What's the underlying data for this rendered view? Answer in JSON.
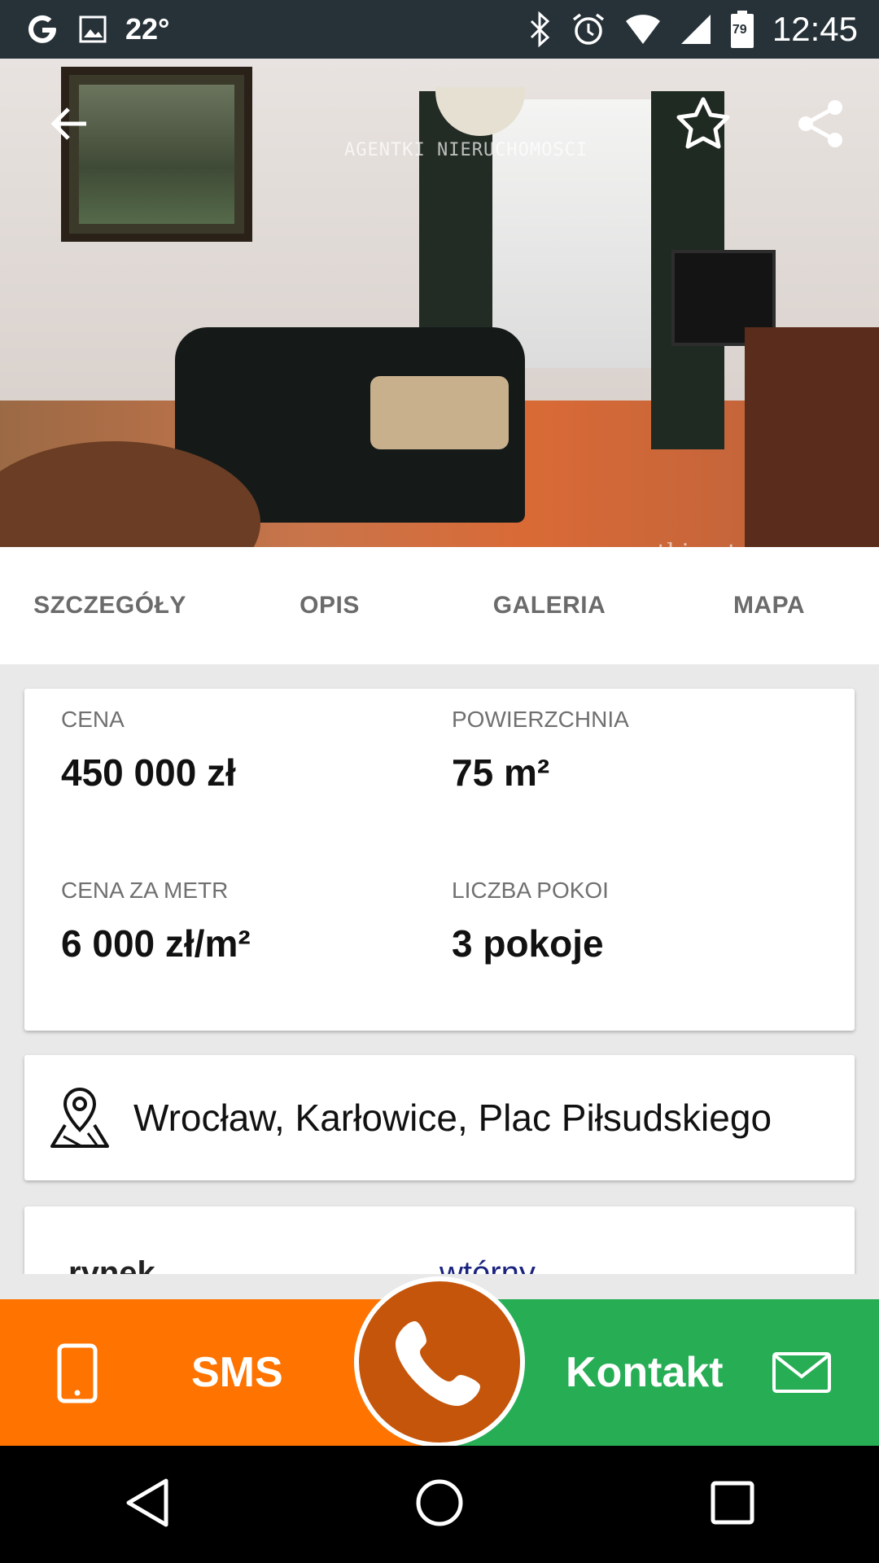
{
  "status_bar": {
    "temperature": "22°",
    "battery": "79",
    "time": "12:45"
  },
  "hero": {
    "watermark": "AGENTKI NIERUCHOMOSCI",
    "watermark_url": "www.agentki.net"
  },
  "tabs": [
    {
      "label": "SZCZEGÓŁY"
    },
    {
      "label": "OPIS"
    },
    {
      "label": "GALERIA"
    },
    {
      "label": "MAPA"
    }
  ],
  "stats": {
    "price_label": "CENA",
    "price_value": "450 000 zł",
    "area_label": "POWIERZCHNIA",
    "area_value": "75 m²",
    "price_per_m_label": "CENA ZA METR",
    "price_per_m_value": "6 000 zł/m²",
    "rooms_label": "LICZBA POKOI",
    "rooms_value": "3 pokoje"
  },
  "location": {
    "address": "Wrocław, Karłowice, Plac Piłsudskiego"
  },
  "details": {
    "rows": [
      {
        "label": "rynek",
        "value": "wtórny"
      }
    ]
  },
  "actions": {
    "sms_label": "SMS",
    "contact_label": "Kontakt"
  },
  "colors": {
    "accent_orange": "#ff7300",
    "call_orange_dark": "#c4550a",
    "contact_green": "#27ae55",
    "status_bar": "#263238"
  }
}
